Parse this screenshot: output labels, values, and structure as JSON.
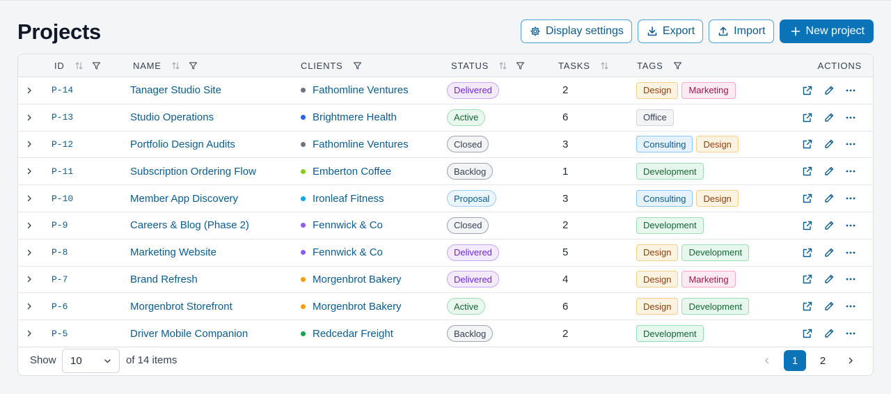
{
  "header": {
    "title": "Projects"
  },
  "toolbar": {
    "display_settings": "Display settings",
    "export": "Export",
    "import": "Import",
    "new_project": "New project"
  },
  "table": {
    "columns": {
      "id": "ID",
      "name": "NAME",
      "clients": "CLIENTS",
      "status": "STATUS",
      "tasks": "TASKS",
      "tags": "TAGS",
      "actions": "ACTIONS"
    },
    "rows": [
      {
        "id": "P-14",
        "name": "Tanager Studio Site",
        "client": "Fathomline Ventures",
        "client_color": "#6b7280",
        "status": "Delivered",
        "tasks": "2",
        "tags": [
          "Design",
          "Marketing"
        ]
      },
      {
        "id": "P-13",
        "name": "Studio Operations",
        "client": "Brightmere Health",
        "client_color": "#2563eb",
        "status": "Active",
        "tasks": "6",
        "tags": [
          "Office"
        ]
      },
      {
        "id": "P-12",
        "name": "Portfolio Design Audits",
        "client": "Fathomline Ventures",
        "client_color": "#6b7280",
        "status": "Closed",
        "tasks": "3",
        "tags": [
          "Consulting",
          "Design"
        ]
      },
      {
        "id": "P-11",
        "name": "Subscription Ordering Flow",
        "client": "Emberton Coffee",
        "client_color": "#84cc16",
        "status": "Backlog",
        "tasks": "1",
        "tags": [
          "Development"
        ]
      },
      {
        "id": "P-10",
        "name": "Member App Discovery",
        "client": "Ironleaf Fitness",
        "client_color": "#0ea5e9",
        "status": "Proposal",
        "tasks": "3",
        "tags": [
          "Consulting",
          "Design"
        ]
      },
      {
        "id": "P-9",
        "name": "Careers & Blog (Phase 2)",
        "client": "Fennwick & Co",
        "client_color": "#8b5cf6",
        "status": "Closed",
        "tasks": "2",
        "tags": [
          "Development"
        ]
      },
      {
        "id": "P-8",
        "name": "Marketing Website",
        "client": "Fennwick & Co",
        "client_color": "#8b5cf6",
        "status": "Delivered",
        "tasks": "5",
        "tags": [
          "Design",
          "Development"
        ]
      },
      {
        "id": "P-7",
        "name": "Brand Refresh",
        "client": "Morgenbrot Bakery",
        "client_color": "#f59e0b",
        "status": "Delivered",
        "tasks": "4",
        "tags": [
          "Design",
          "Marketing"
        ]
      },
      {
        "id": "P-6",
        "name": "Morgenbrot Storefront",
        "client": "Morgenbrot Bakery",
        "client_color": "#f59e0b",
        "status": "Active",
        "tasks": "6",
        "tags": [
          "Design",
          "Development"
        ]
      },
      {
        "id": "P-5",
        "name": "Driver Mobile Companion",
        "client": "Redcedar Freight",
        "client_color": "#16a34a",
        "status": "Backlog",
        "tasks": "2",
        "tags": [
          "Development"
        ]
      }
    ]
  },
  "status_styles": {
    "Delivered": {
      "bg": "#f3eafd",
      "border": "#c9a6f0",
      "fg": "#6d28d9"
    },
    "Active": {
      "bg": "#e9f8ef",
      "border": "#9fdcb6",
      "fg": "#166534"
    },
    "Closed": {
      "bg": "#f3f4f6",
      "border": "#9ca3af",
      "fg": "#374151"
    },
    "Backlog": {
      "bg": "#f3f4f6",
      "border": "#9ca3af",
      "fg": "#374151"
    },
    "Proposal": {
      "bg": "#eaf5fd",
      "border": "#9dcdf0",
      "fg": "#0b5c8e"
    }
  },
  "tag_styles": {
    "Design": {
      "bg": "#fdf3e1",
      "border": "#f2cf8a",
      "fg": "#92400e"
    },
    "Marketing": {
      "bg": "#fdeaf2",
      "border": "#f1a7c8",
      "fg": "#9d174d"
    },
    "Office": {
      "bg": "#f3f4f6",
      "border": "#d1d5db",
      "fg": "#374151"
    },
    "Consulting": {
      "bg": "#e6f3fc",
      "border": "#8cc6ee",
      "fg": "#0b5c8e"
    },
    "Development": {
      "bg": "#e6f7ee",
      "border": "#9fdcb6",
      "fg": "#166534"
    }
  },
  "footer": {
    "show_label": "Show",
    "page_size": "10",
    "of_items": "of 14 items",
    "pages": [
      "1",
      "2"
    ],
    "current_page": "1"
  },
  "colors": {
    "accent": "#0b74b8",
    "link": "#0b5c8e"
  },
  "icons": {
    "display_settings": "gear-icon",
    "export": "download-icon",
    "import": "upload-icon",
    "new_project": "plus-icon",
    "sort": "sort-icon",
    "filter": "filter-icon",
    "row_expand": "chevron-right-icon",
    "open": "external-link-icon",
    "edit": "pencil-icon",
    "more": "ellipsis-icon"
  }
}
